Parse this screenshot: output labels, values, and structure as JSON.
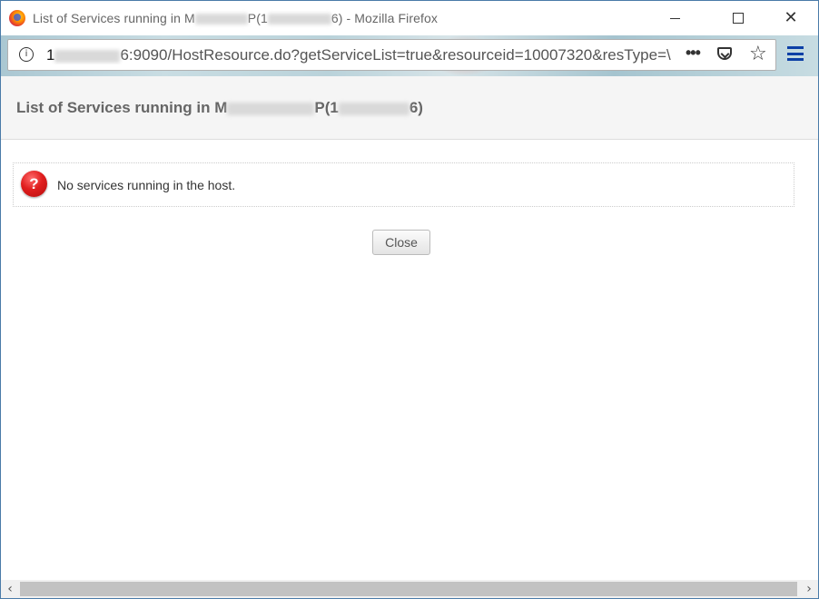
{
  "window": {
    "title_prefix": "List of Services running in M",
    "title_mid": "P(1",
    "title_suffix": "6) - Mozilla Firefox"
  },
  "urlbar": {
    "url_start": "1",
    "url_rest": "6:9090/HostResource.do?getServiceList=true&resourceid=10007320&resType=\\"
  },
  "dialog": {
    "title_prefix": "List of Services running in M",
    "title_mid": "P(1",
    "title_suffix": "6)",
    "message": "No services running in the host.",
    "close_label": "Close"
  },
  "icons": {
    "info": "info-icon",
    "more": "more-actions-icon",
    "pocket": "pocket-icon",
    "bookmark": "star-icon",
    "menu": "hamburger-menu-icon",
    "error": "question-error-icon"
  },
  "colors": {
    "error_red": "#e01e1e",
    "menu_blue": "#0b3fa6",
    "header_bg": "#f5f5f5"
  }
}
